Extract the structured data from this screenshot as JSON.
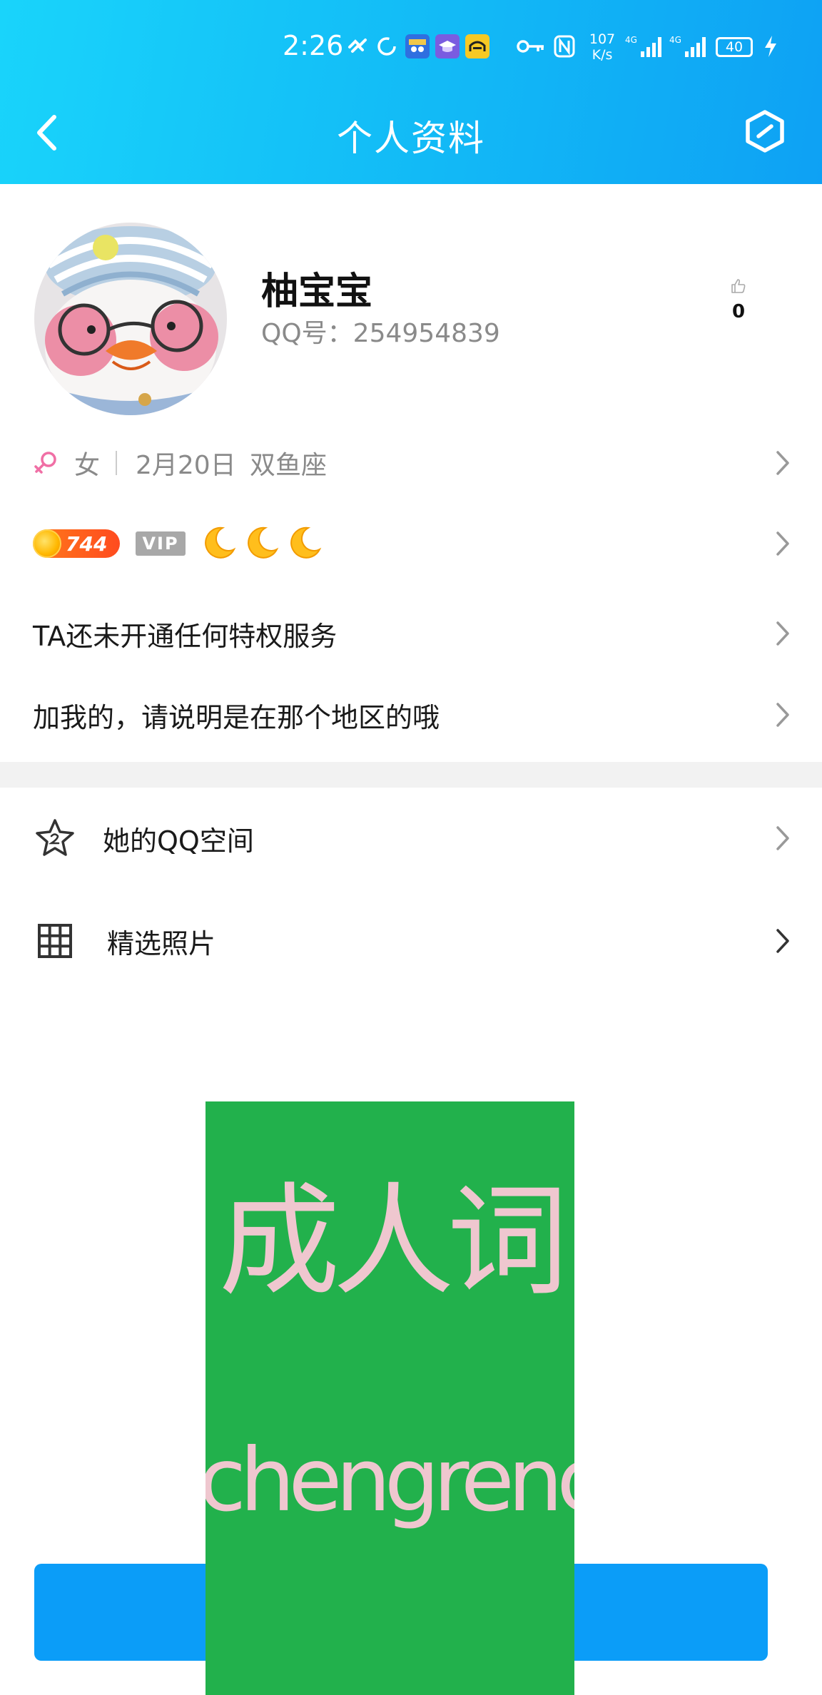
{
  "status_bar": {
    "time": "2:26",
    "net_speed_value": "107",
    "net_speed_unit": "K/s",
    "signal1": "4G",
    "signal2": "4G",
    "battery": "40"
  },
  "header": {
    "title": "个人资料"
  },
  "profile": {
    "nickname": "柚宝宝",
    "qq_label": "QQ号：254954839",
    "likes": "0"
  },
  "info_row": {
    "gender": "女",
    "birthday": "2月20日",
    "zodiac": "双鱼座"
  },
  "badges": {
    "level": "744",
    "vip": "VIP"
  },
  "privilege_text": "TA还未开通任何特权服务",
  "signature_text": "加我的，请说明是在那个地区的哦",
  "list": {
    "qzone_label": "她的QQ空间",
    "photos_label": "精选照片"
  },
  "watermark": {
    "cn": "成人词",
    "en": "chengrenci.com"
  },
  "colors": {
    "header_start": "#19d4fb",
    "header_end": "#0ea1f4",
    "button": "#0b9df8",
    "watermark_bg": "#22b14c",
    "watermark_text": "#efc7cf"
  }
}
